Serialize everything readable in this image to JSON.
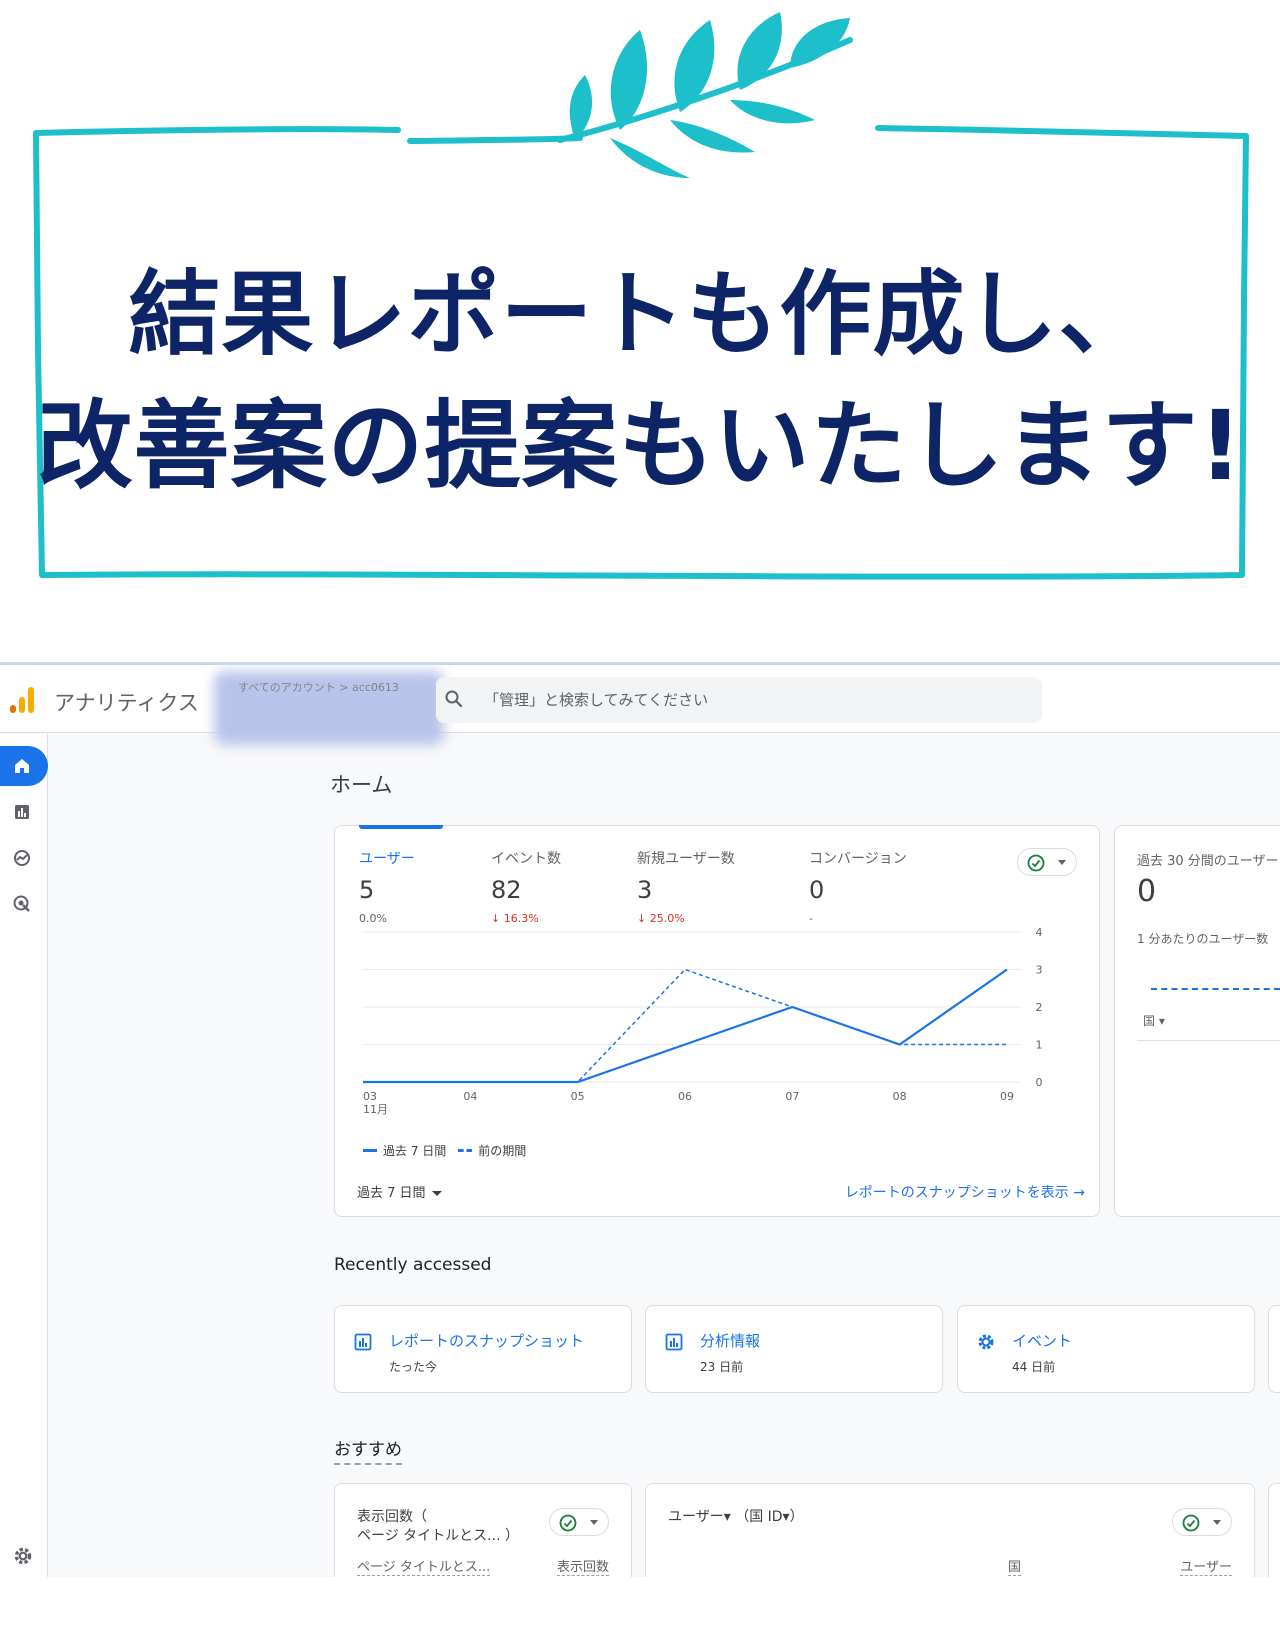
{
  "banner": {
    "headline_line1": "結果レポートも作成し、",
    "headline_line2": "改善案の提案もいたします!",
    "frame_color": "#1dbfca",
    "text_color": "#0d2466"
  },
  "analytics": {
    "app_name": "アナリティクス",
    "account_breadcrumb": "すべてのアカウント > acc0613",
    "search_placeholder": "「管理」と検索してみてください",
    "page_title": "ホーム",
    "metrics": [
      {
        "label": "ユーザー",
        "value": "5",
        "change": "0.0%",
        "direction": "flat"
      },
      {
        "label": "イベント数",
        "value": "82",
        "change": "16.3%",
        "direction": "down"
      },
      {
        "label": "新規ユーザー数",
        "value": "3",
        "change": "25.0%",
        "direction": "down"
      },
      {
        "label": "コンバージョン",
        "value": "0",
        "change": "-",
        "direction": "flat"
      }
    ],
    "legend_current": "過去 7 日間",
    "legend_previous": "前の期間",
    "range_select": "過去 7 日間",
    "snapshot_link": "レポートのスナップショットを表示 →",
    "realtime": {
      "label": "過去 30 分間のユーザー",
      "value": "0",
      "sub_label": "1 分あたりのユーザー数",
      "country_label": "国"
    },
    "recent_title": "Recently accessed",
    "recent_items": [
      {
        "title": "レポートのスナップショット",
        "time": "たった今",
        "icon": "report-icon"
      },
      {
        "title": "分析情報",
        "time": "23 日前",
        "icon": "report-icon"
      },
      {
        "title": "イベント",
        "time": "44 日前",
        "icon": "gear-icon"
      }
    ],
    "reco_title": "おすすめ",
    "reco_cards": [
      {
        "title_line1": "表示回数（",
        "title_line2": "ページ タイトルとス... ）",
        "col1": "ページ タイトルとス...",
        "col2": "表示回数"
      },
      {
        "title_line1": "ユーザー▾ （国 ID▾）",
        "title_line2": "",
        "col1": "国",
        "col2": "ユーザー"
      }
    ],
    "accent_color": "#1a73e8"
  },
  "chart_data": {
    "type": "line",
    "x_tick_labels": [
      "03",
      "04",
      "05",
      "06",
      "07",
      "08",
      "09"
    ],
    "x_sub_label": "11月",
    "ylim": [
      0,
      4
    ],
    "y_ticks": [
      "0",
      "1",
      "2",
      "3",
      "4"
    ],
    "series": [
      {
        "name": "過去 7 日間",
        "style": "solid",
        "values": [
          0,
          0,
          0,
          1,
          2,
          1,
          3
        ]
      },
      {
        "name": "前の期間",
        "style": "dashed",
        "values": [
          0,
          0,
          0,
          3,
          2,
          1,
          1
        ]
      }
    ],
    "grid": true
  }
}
